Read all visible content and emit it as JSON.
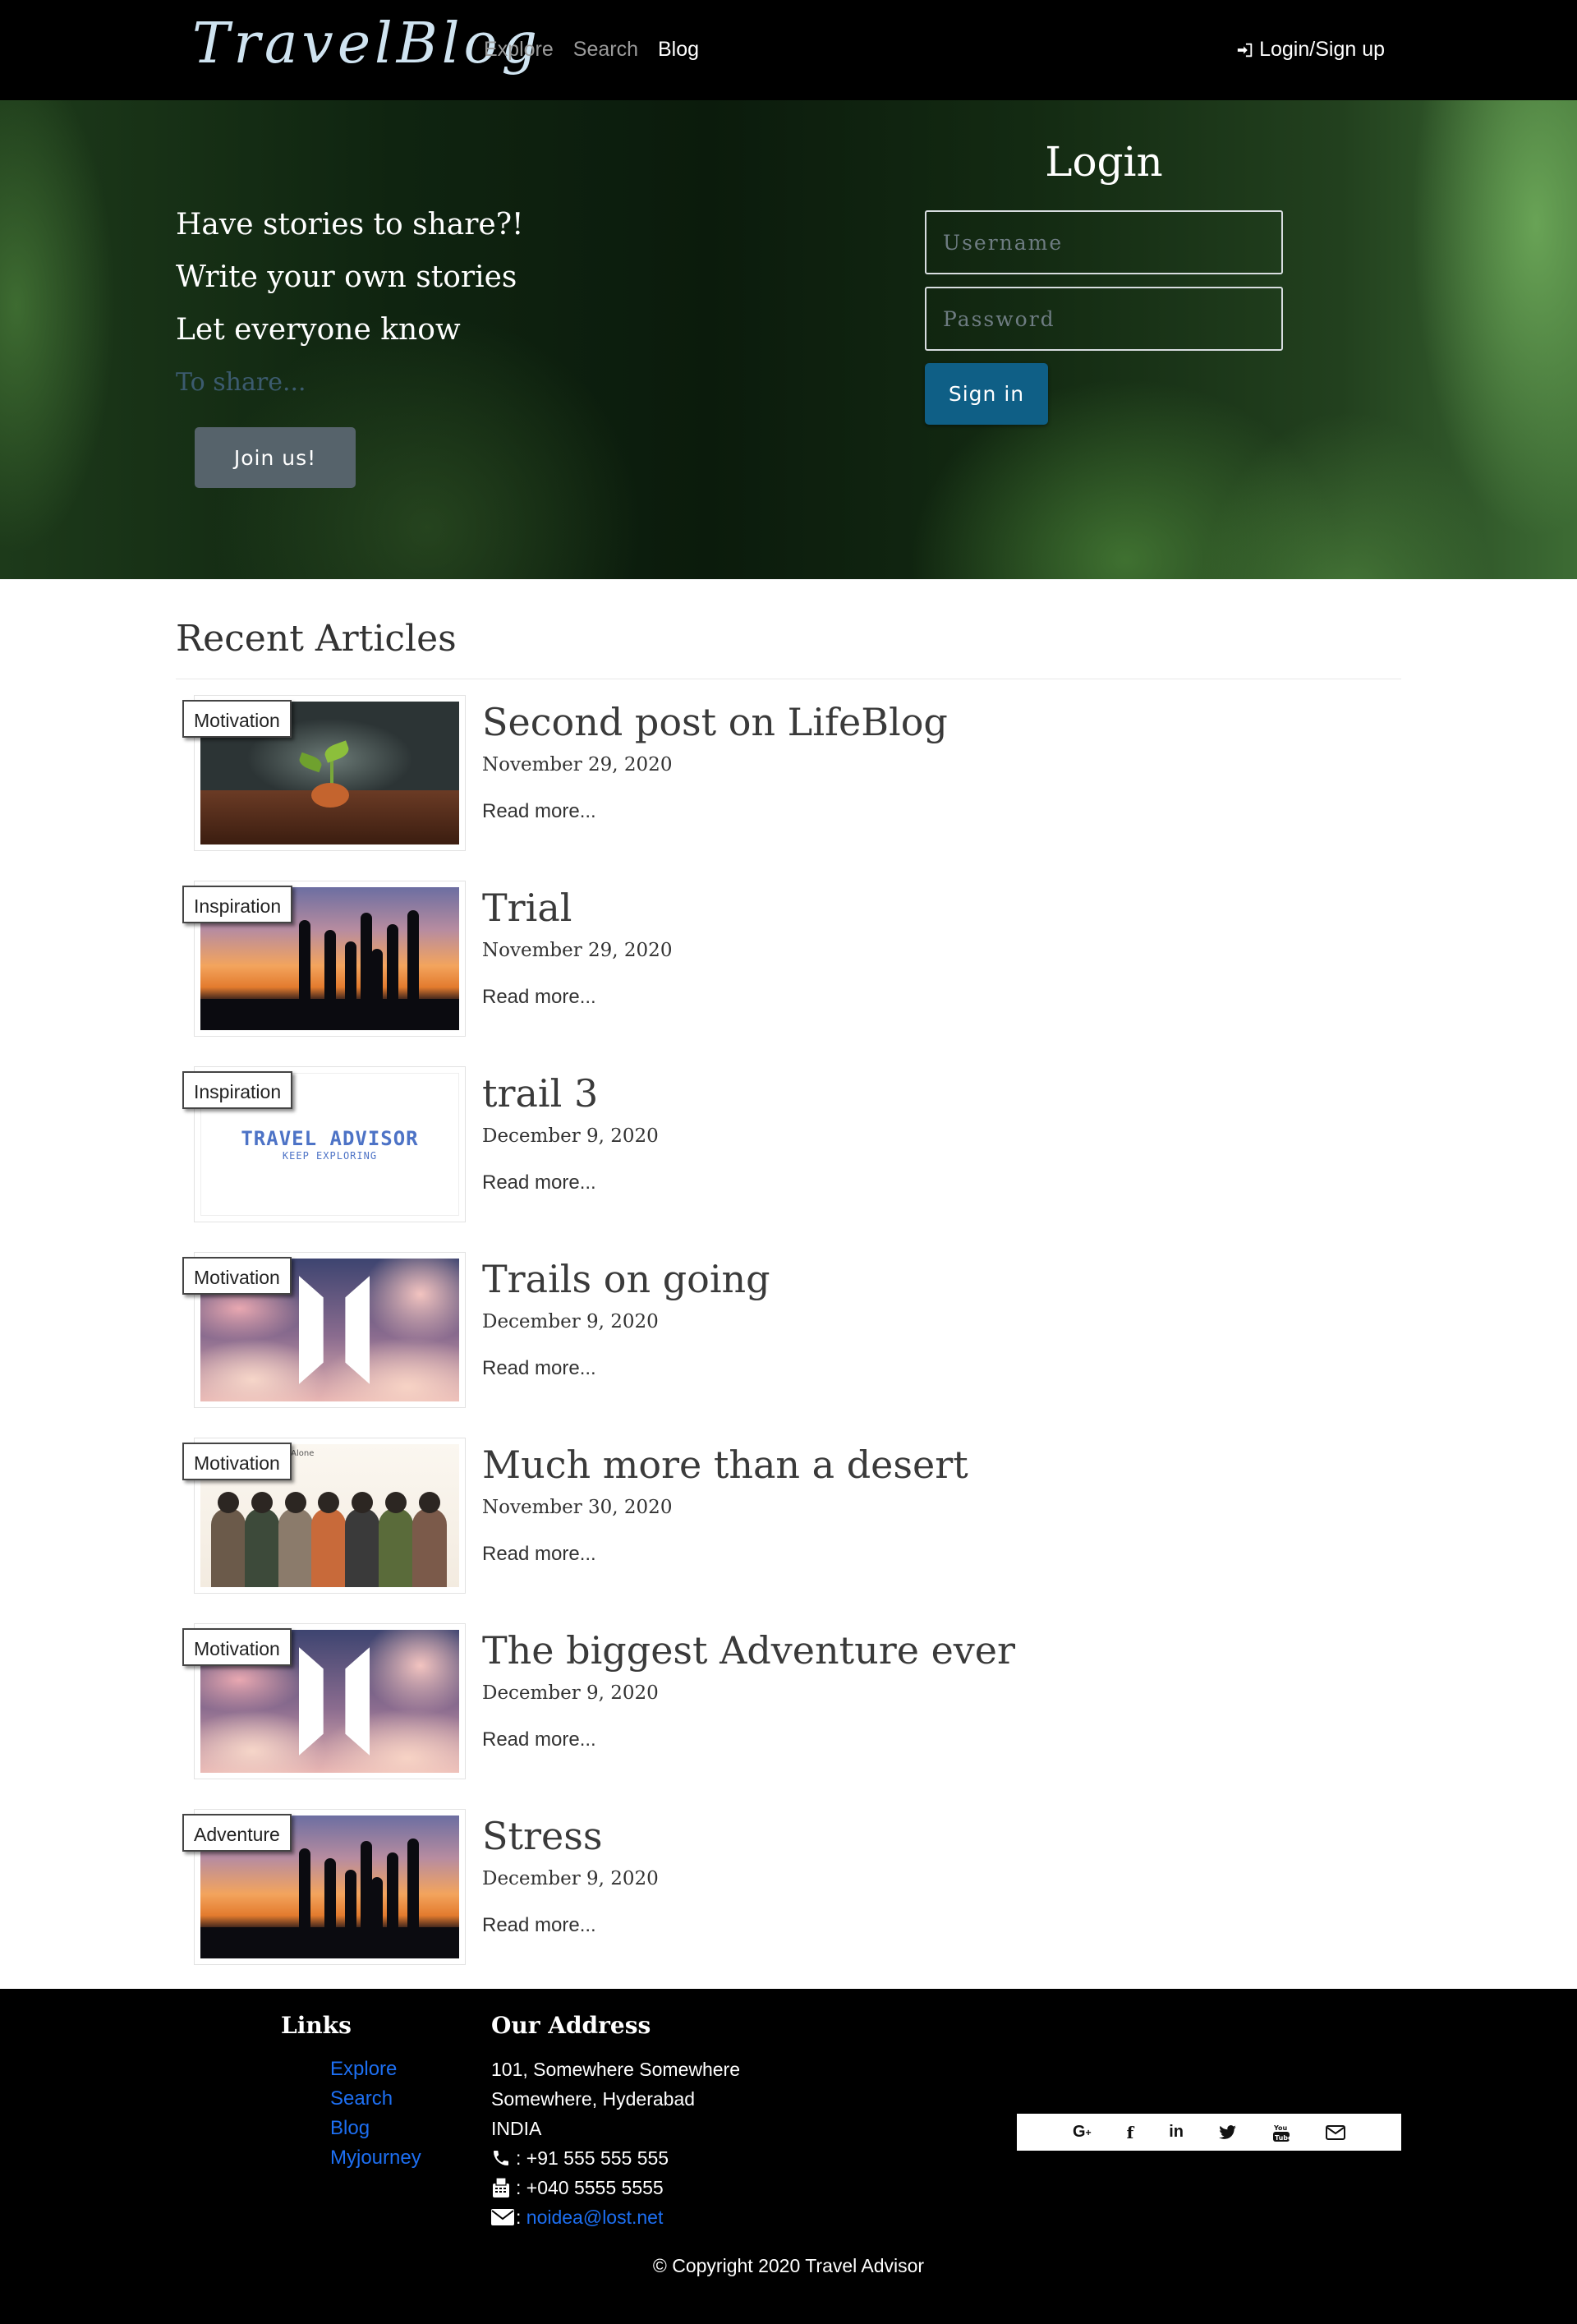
{
  "navbar": {
    "brand": "TravelBlog",
    "links": [
      {
        "label": "Explore",
        "active": false
      },
      {
        "label": "Search",
        "active": false
      },
      {
        "label": "Blog",
        "active": true
      }
    ],
    "login_label": "Login/Sign up"
  },
  "hero": {
    "lines": [
      "Have stories to share?!",
      "Write your own stories",
      "Let everyone know",
      "To share..."
    ],
    "join_label": "Join us!",
    "login": {
      "title": "Login",
      "username_placeholder": "Username",
      "password_placeholder": "Password",
      "signin_label": "Sign in"
    }
  },
  "articles": {
    "heading": "Recent Articles",
    "read_more": "Read more...",
    "items": [
      {
        "tag": "Motivation",
        "title": "Second post on LifeBlog",
        "date": "November 29, 2020",
        "image": "plant"
      },
      {
        "tag": "Inspiration",
        "title": "Trial",
        "date": "November 29, 2020",
        "image": "sunset"
      },
      {
        "tag": "Inspiration",
        "title": "trail 3",
        "date": "December 9, 2020",
        "image": "logo"
      },
      {
        "tag": "Motivation",
        "title": "Trails on going",
        "date": "December 9, 2020",
        "image": "clouds"
      },
      {
        "tag": "Motivation",
        "title": "Much more than a desert",
        "date": "November 30, 2020",
        "image": "group"
      },
      {
        "tag": "Motivation",
        "title": "The biggest Adventure ever",
        "date": "December 9, 2020",
        "image": "clouds"
      },
      {
        "tag": "Adventure",
        "title": "Stress",
        "date": "December 9, 2020",
        "image": "sunset"
      }
    ],
    "logo_image_text": {
      "line1": "TRAVEL ADVISOR",
      "line2": "KEEP EXPLORING"
    },
    "group_image_text": "Never Walk Alone"
  },
  "footer": {
    "links_heading": "Links",
    "links": [
      "Explore",
      "Search",
      "Blog",
      "Myjourney"
    ],
    "address_heading": "Our Address",
    "address_lines": [
      "101, Somewhere Somewhere",
      "Somewhere, Hyderabad",
      "INDIA"
    ],
    "phone": ": +91 555 555 555",
    "fax": ": +040 5555 5555",
    "email": "noidea@lost.net",
    "socials": [
      "google-plus",
      "facebook",
      "linkedin",
      "twitter",
      "youtube",
      "mail"
    ],
    "copyright": "© Copyright 2020 Travel Advisor"
  },
  "colors": {
    "navbar_bg": "#000000",
    "link_blue": "#1d6ff2",
    "signin_bg": "#0f5f86",
    "join_bg": "#56636b"
  }
}
